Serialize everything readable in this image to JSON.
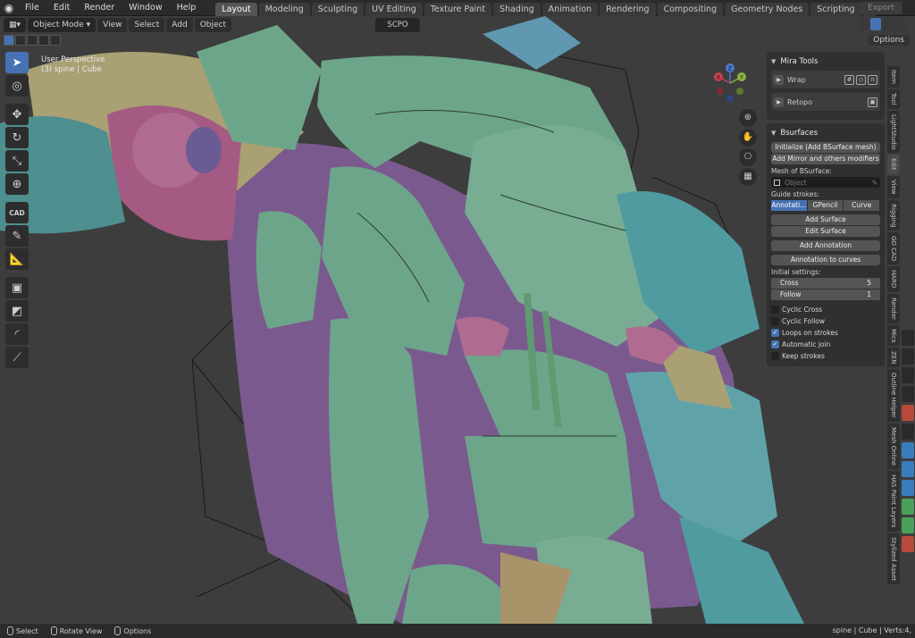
{
  "menubar": {
    "items": [
      "File",
      "Edit",
      "Render",
      "Window",
      "Help"
    ],
    "tabs": [
      "Layout",
      "Modeling",
      "Sculpting",
      "UV Editing",
      "Texture Paint",
      "Shading",
      "Animation",
      "Rendering",
      "Compositing",
      "Geometry Nodes",
      "Scripting"
    ],
    "active_tab": "Layout",
    "add_tab": "+",
    "export": "Export"
  },
  "header": {
    "mode": "Object Mode",
    "view": "View",
    "select": "Select",
    "add": "Add",
    "object": "Object",
    "scpo": "SCPO",
    "options": "Options"
  },
  "viewport_info": {
    "line1": "User Perspective",
    "line2": "(3) spine | Cube"
  },
  "gizmo": {
    "x": "X",
    "y": "Y",
    "z": "Z"
  },
  "mira": {
    "title": "Mira Tools",
    "wrap": "Wrap",
    "retopo": "Retopo"
  },
  "bsurfaces": {
    "title": "Bsurfaces",
    "initialize": "Initialize (Add BSurface mesh)",
    "add_mirror": "Add Mirror and others modifiers",
    "mesh_label": "Mesh of BSurface:",
    "mesh_placeholder": "Object",
    "guide_label": "Guide strokes:",
    "guide_options": [
      "Annotati...",
      "GPencil",
      "Curve"
    ],
    "add_surface": "Add Surface",
    "edit_surface": "Edit Surface",
    "add_annotation": "Add Annotation",
    "annotation_to_curves": "Annotation to curves",
    "initial_label": "Initial settings:",
    "cross_label": "Cross",
    "cross_value": "5",
    "follow_label": "Follow",
    "follow_value": "1",
    "checks": [
      {
        "label": "Cyclic Cross",
        "checked": false
      },
      {
        "label": "Cyclic Follow",
        "checked": false
      },
      {
        "label": "Loops on strokes",
        "checked": true
      },
      {
        "label": "Automatic join",
        "checked": true
      },
      {
        "label": "Keep strokes",
        "checked": false
      }
    ]
  },
  "side_tabs": [
    "Item",
    "Tool",
    "LightStudio",
    "Edit",
    "View",
    "Rigging",
    "GO CAD",
    "HARD",
    "Render",
    "Mics",
    "ZEN",
    "Outline Helper",
    "Mesh Online",
    "HAS Paint Layers",
    "Stylized Asset"
  ],
  "toolbar": {
    "cad_label": "CAD"
  },
  "statusbar": {
    "select": "Select",
    "rotate": "Rotate View",
    "options": "Options",
    "right": "spine | Cube | Verts:4,"
  }
}
